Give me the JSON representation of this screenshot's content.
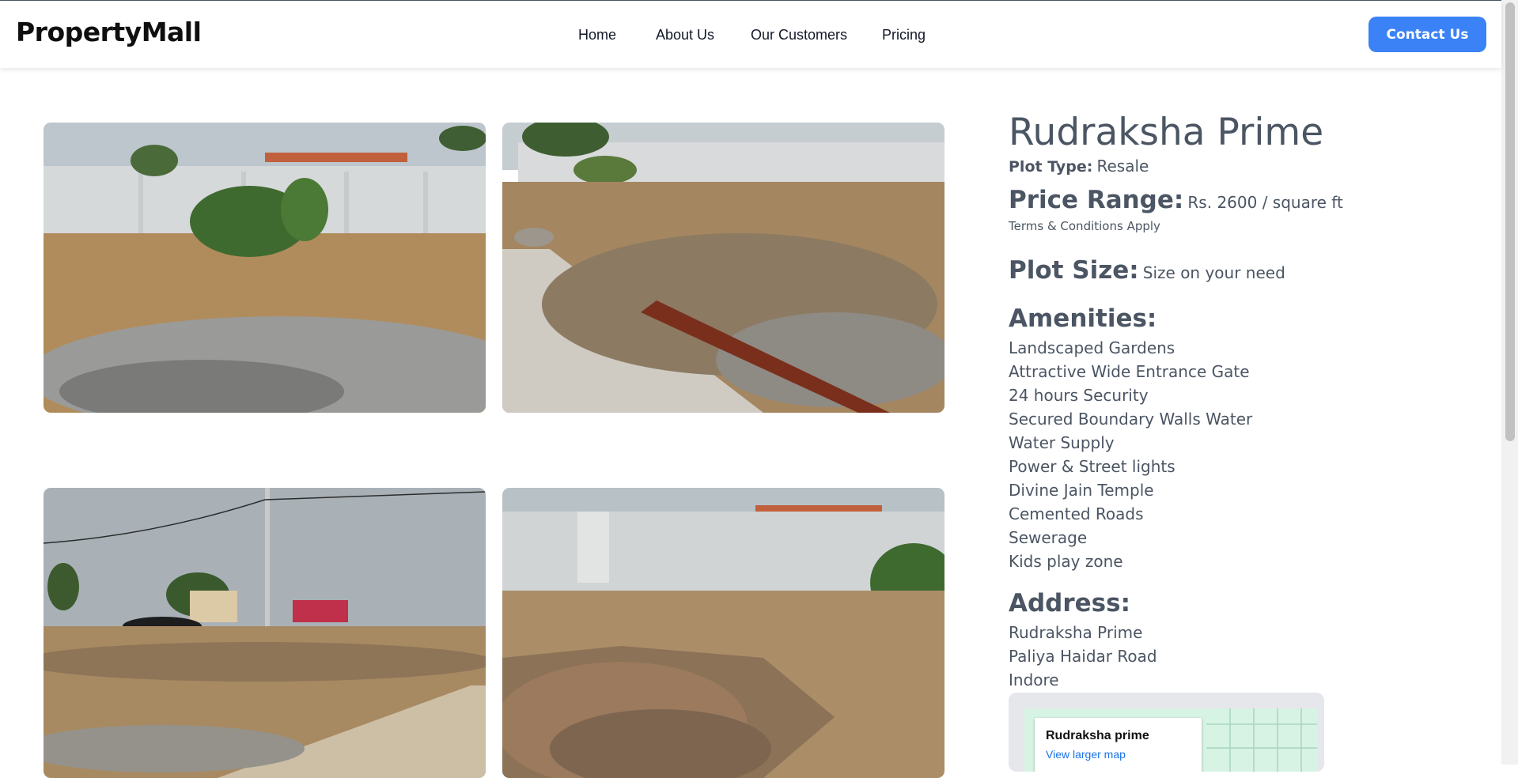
{
  "navbar": {
    "logo": "PropertyMall",
    "links": [
      {
        "label": "Home"
      },
      {
        "label": "About Us"
      },
      {
        "label": "Our Customers"
      },
      {
        "label": "Pricing"
      }
    ],
    "contact_label": "Contact Us"
  },
  "property": {
    "title": "Rudraksha Prime",
    "plot_type_label": "Plot Type:",
    "plot_type_value": "Resale",
    "price_range_label": "Price Range:",
    "price_range_value": "Rs. 2600 / square ft",
    "terms_note": "Terms & Conditions Apply",
    "plot_size_label": "Plot Size:",
    "plot_size_value": "Size on your need",
    "amenities_label": "Amenities:",
    "amenities": [
      "Landscaped Gardens",
      "Attractive Wide Entrance Gate",
      "24 hours Security",
      "Secured Boundary Walls Water",
      "Water Supply",
      "Power & Street lights",
      "Divine Jain Temple",
      "Cemented Roads",
      "Sewerage",
      "Kids play zone"
    ],
    "address_label": "Address:",
    "address_lines": [
      "Rudraksha Prime",
      "Paliya Haidar Road",
      "Indore"
    ]
  },
  "map": {
    "place_name": "Rudraksha prime",
    "link_label": "View larger map"
  },
  "colors": {
    "accent": "#3b82f6",
    "text": "#4b5563"
  }
}
